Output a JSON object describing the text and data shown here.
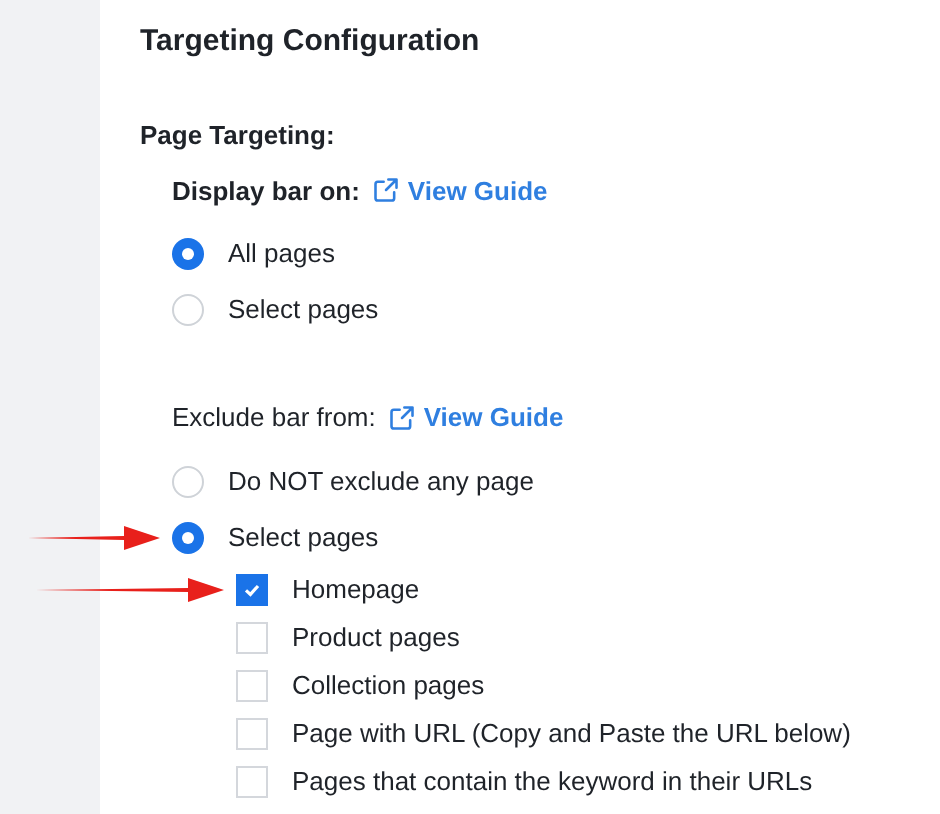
{
  "title": "Targeting Configuration",
  "section_label": "Page Targeting:",
  "display": {
    "label": "Display bar on:",
    "link": "View Guide",
    "options": [
      {
        "label": "All pages",
        "selected": true
      },
      {
        "label": "Select pages",
        "selected": false
      }
    ]
  },
  "exclude": {
    "label": "Exclude bar from:",
    "link": "View Guide",
    "options": [
      {
        "label": "Do NOT exclude any page",
        "selected": false,
        "arrow": false
      },
      {
        "label": "Select pages",
        "selected": true,
        "arrow": true
      }
    ],
    "pages": [
      {
        "label": "Homepage",
        "checked": true,
        "arrow": true
      },
      {
        "label": "Product pages",
        "checked": false,
        "arrow": false
      },
      {
        "label": "Collection pages",
        "checked": false,
        "arrow": false
      },
      {
        "label": "Page with URL (Copy and Paste the URL below)",
        "checked": false,
        "arrow": false
      },
      {
        "label": "Pages that contain the keyword in their URLs",
        "checked": false,
        "arrow": false
      }
    ]
  }
}
